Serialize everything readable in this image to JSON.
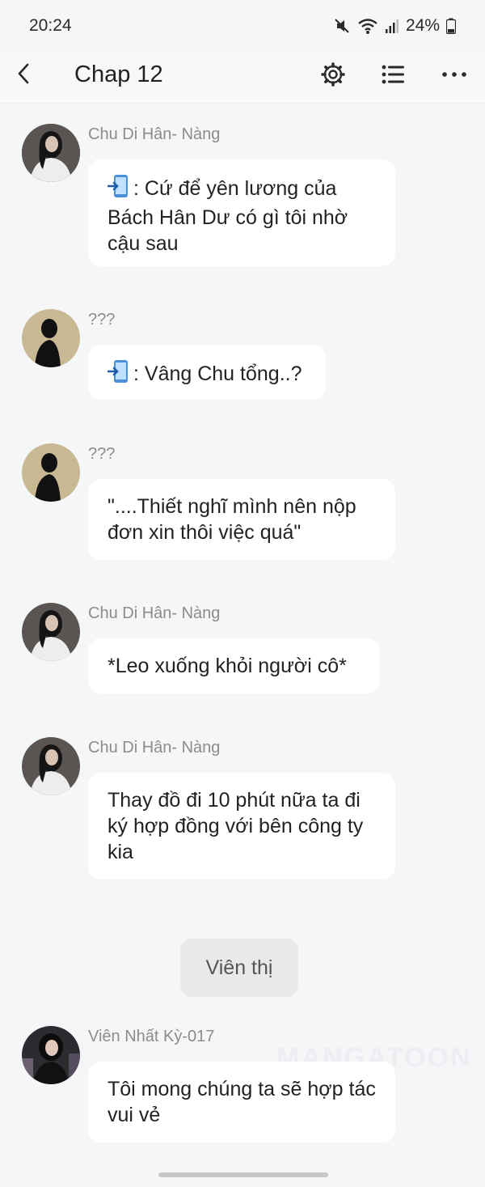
{
  "status": {
    "time": "20:24",
    "battery": "24%"
  },
  "toolbar": {
    "title": "Chap 12"
  },
  "messages": [
    {
      "sender": "Chu Di Hân- Nàng",
      "text": ": Cứ để yên lương của Bách Hân Dư có gì tôi nhờ cậu sau",
      "icon": "phone-arrow-icon"
    },
    {
      "sender": "???",
      "text": ": Vâng Chu tổng..?",
      "icon": "phone-arrow-icon"
    },
    {
      "sender": "???",
      "text": "\"....Thiết nghĩ mình nên nộp đơn xin thôi việc quá\""
    },
    {
      "sender": "Chu Di Hân- Nàng",
      "text": "*Leo xuống khỏi người cô*"
    },
    {
      "sender": "Chu Di Hân- Nàng",
      "text": "Thay đồ đi 10 phút nữa ta đi ký hợp đồng với bên công ty kia"
    },
    {
      "sender": "Viên Nhất Kỳ-017",
      "text": "Tôi mong chúng ta sẽ hợp tác vui vẻ"
    }
  ],
  "narration": "Viên thị",
  "watermark": "MANGATOON"
}
